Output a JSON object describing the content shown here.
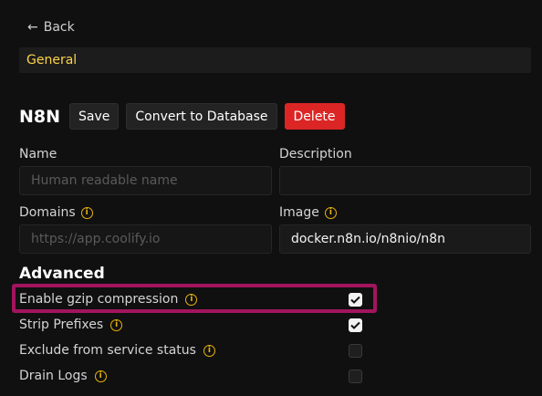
{
  "nav": {
    "back_label": "Back"
  },
  "tabs": {
    "general": "General"
  },
  "header": {
    "title": "N8N",
    "save": "Save",
    "convert": "Convert to Database",
    "delete": "Delete"
  },
  "form": {
    "name_label": "Name",
    "name_placeholder": "Human readable name",
    "description_label": "Description",
    "description_value": "",
    "domains_label": "Domains",
    "domains_placeholder": "https://app.coolify.io",
    "image_label": "Image",
    "image_value": "docker.n8n.io/n8nio/n8n"
  },
  "advanced": {
    "title": "Advanced",
    "options": [
      {
        "label": "Enable gzip compression",
        "checked": true
      },
      {
        "label": "Strip Prefixes",
        "checked": true
      },
      {
        "label": "Exclude from service status",
        "checked": false
      },
      {
        "label": "Drain Logs",
        "checked": false
      }
    ]
  },
  "colors": {
    "accent": "#fcd34d",
    "delete": "#dc2626",
    "highlight": "#a3145e",
    "info_icon": "#eab308"
  }
}
